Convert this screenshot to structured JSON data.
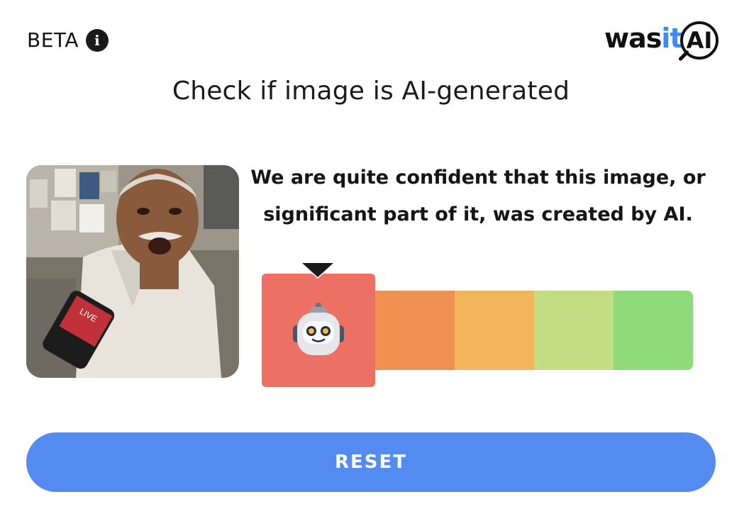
{
  "header": {
    "beta_label": "BETA",
    "info_icon": "info-icon",
    "logo": {
      "was": "was",
      "it": "it",
      "ai": "AI"
    }
  },
  "title": "Check if image is AI-generated",
  "image": {
    "description_icon": "photo"
  },
  "result": {
    "verdict_line1": "We are quite confident that this image, or",
    "verdict_line2": "significant part of it, was created by AI.",
    "selected_level": 1,
    "levels": 5,
    "selected_icon": "robot-icon"
  },
  "scale": {
    "colors": [
      "#ec7063",
      "#ef9251",
      "#f3b55a",
      "#c2dd82",
      "#8fdb7c"
    ]
  },
  "actions": {
    "reset_label": "RESET"
  },
  "theme": {
    "accent": "#548bf1",
    "logo_it": "#3d8bf2",
    "dark": "#1a1a1a"
  }
}
